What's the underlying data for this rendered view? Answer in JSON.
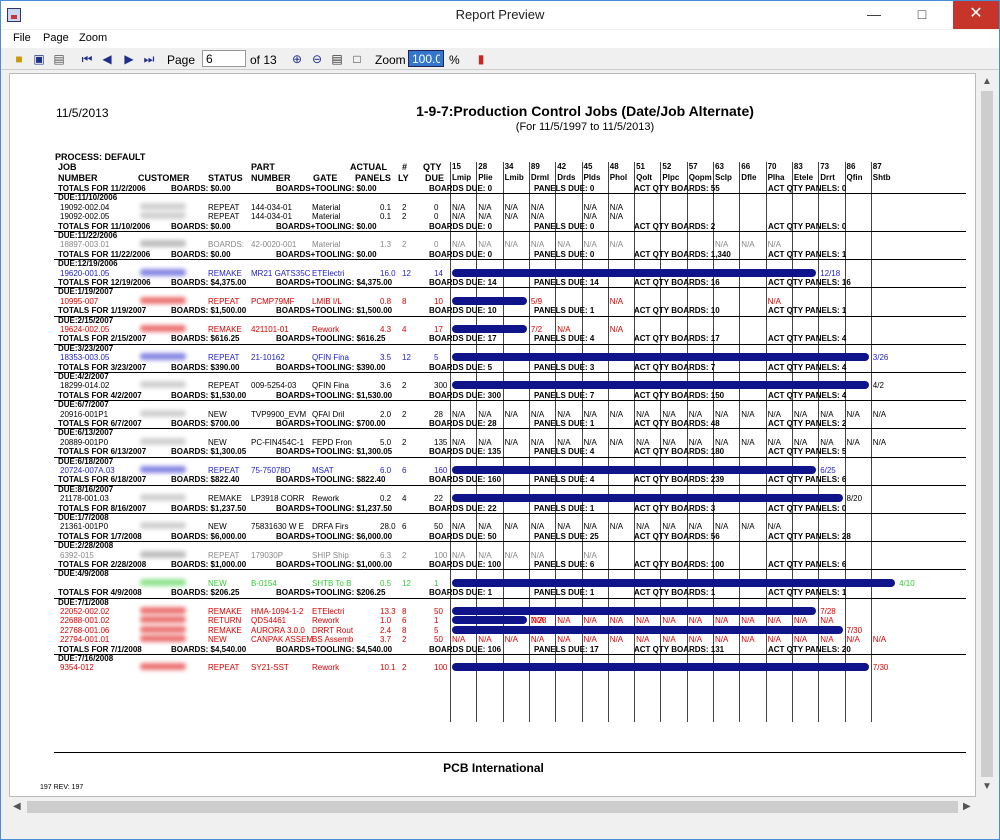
{
  "window": {
    "title": "Report Preview"
  },
  "menu": {
    "file": "File",
    "page": "Page",
    "zoom": "Zoom"
  },
  "toolbar": {
    "page_label": "Page",
    "page": "6",
    "of": "of 13",
    "zoom_label": "Zoom",
    "zoom": "100.0",
    "percent": "%"
  },
  "report": {
    "date": "11/5/2013",
    "title": "1-9-7:Production Control Jobs (Date/Job Alternate)",
    "subtitle": "(For 11/5/1997  to 11/5/2013)",
    "process": "PROCESS:  DEFAULT",
    "footer": "PCB International",
    "rev": "197  REV:  197",
    "headers": {
      "job1": "JOB",
      "job2": "NUMBER",
      "customer": "CUSTOMER",
      "status": "STATUS",
      "part1": "PART",
      "part2": "NUMBER",
      "gate": "GATE",
      "actual1": "ACTUAL",
      "actual2": "PANELS",
      "num1": "#",
      "num2": "LY",
      "qty1": "QTY",
      "qty2": "DUE"
    },
    "steps": [
      [
        "15",
        "Lmip"
      ],
      [
        "28",
        "Plie"
      ],
      [
        "34",
        "Lmib"
      ],
      [
        "89",
        "Drml"
      ],
      [
        "42",
        "Drds"
      ],
      [
        "45",
        "Plds"
      ],
      [
        "48",
        "Phol"
      ],
      [
        "51",
        "Qolt"
      ],
      [
        "52",
        "Plpc"
      ],
      [
        "57",
        "Qopm"
      ],
      [
        "63",
        "Sclp"
      ],
      [
        "66",
        "Dfle"
      ],
      [
        "70",
        "Plha"
      ],
      [
        "83",
        "Etele"
      ],
      [
        "73",
        "Drrt"
      ],
      [
        "86",
        "Qfin"
      ],
      [
        "87",
        "Shtb"
      ]
    ],
    "lines": [
      {
        "t": "total",
        "a": "TOTALS FOR 11/2/2006",
        "b": "BOARDS: $0.00",
        "c": "BOARDS+TOOLING: $0.00",
        "d": "BOARDS DUE: 0",
        "e": "PANELS DUE: 0",
        "f": "ACT QTY BOARDS: 55",
        "g": "ACT QTY PANELS: 0"
      },
      {
        "t": "due",
        "a": "DUE:11/10/2006"
      },
      {
        "t": "job",
        "job": "19092-002.04",
        "status": "REPEAT",
        "part": "144-034-01",
        "gate": "Material",
        "panels": "0.1",
        "ly": "2",
        "qty": "0",
        "na": [
          0,
          1,
          2,
          3,
          5,
          6
        ],
        "color": "#000"
      },
      {
        "t": "job",
        "job": "19092-002.05",
        "status": "REPEAT",
        "part": "144-034-01",
        "gate": "Material",
        "panels": "0.1",
        "ly": "2",
        "qty": "0",
        "na": [
          0,
          1,
          2,
          3,
          5,
          6
        ],
        "color": "#000"
      },
      {
        "t": "total",
        "a": "TOTALS FOR 11/10/2006",
        "b": "BOARDS: $0.00",
        "c": "BOARDS+TOOLING: $0.00",
        "d": "BOARDS DUE: 0",
        "e": "PANELS DUE: 0",
        "f": "ACT QTY BOARDS: 2",
        "g": "ACT QTY PANELS: 0"
      },
      {
        "t": "due",
        "a": "DUE:11/22/2006"
      },
      {
        "t": "job",
        "job": "18897-003.01",
        "status": "BOARDS:",
        "part": "42-0020-001",
        "gate": "Material",
        "panels": "1.3",
        "ly": "2",
        "qty": "0",
        "na": [
          0,
          1,
          2,
          3,
          4,
          5,
          6,
          10,
          11,
          12
        ],
        "color": "#888"
      },
      {
        "t": "total",
        "a": "TOTALS FOR 11/22/2006",
        "b": "BOARDS: $0.00",
        "c": "BOARDS+TOOLING: $0.00",
        "d": "BOARDS DUE: 0",
        "e": "PANELS DUE: 0",
        "f": "ACT QTY BOARDS: 1,340",
        "g": "ACT QTY PANELS: 1"
      },
      {
        "t": "due",
        "a": "DUE:12/19/2006"
      },
      {
        "t": "job",
        "job": "19620-001.05",
        "status": "REMAKE",
        "part": "MR21 GATS35C",
        "gate": "ETElectri",
        "panels": "16.0",
        "ly": "12",
        "qty": "14",
        "bar": [
          0,
          13
        ],
        "end": "12/18",
        "color": "#22c"
      },
      {
        "t": "total",
        "a": "TOTALS FOR 12/19/2006",
        "b": "BOARDS: $4,375.00",
        "c": "BOARDS+TOOLING: $4,375.00",
        "d": "BOARDS DUE: 14",
        "e": "PANELS DUE: 14",
        "f": "ACT QTY BOARDS: 16",
        "g": "ACT QTY PANELS: 16"
      },
      {
        "t": "due",
        "a": "DUE:1/19/2007"
      },
      {
        "t": "job",
        "job": "10995-007",
        "status": "REPEAT",
        "part": "PCMP79MF",
        "gate": "LMIB I/L",
        "panels": "0.8",
        "ly": "8",
        "qty": "10",
        "bar": [
          0,
          2
        ],
        "mid": "5/9",
        "na": [
          6,
          12
        ],
        "color": "#d00"
      },
      {
        "t": "total",
        "a": "TOTALS FOR 1/19/2007",
        "b": "BOARDS: $1,500.00",
        "c": "BOARDS+TOOLING: $1,500.00",
        "d": "BOARDS DUE: 10",
        "e": "PANELS DUE: 1",
        "f": "ACT QTY BOARDS: 10",
        "g": "ACT QTY PANELS: 1"
      },
      {
        "t": "due",
        "a": "DUE:2/15/2007"
      },
      {
        "t": "job",
        "job": "19624-002.05",
        "status": "REMAKE",
        "part": "421101-01",
        "gate": "Rework",
        "panels": "4.3",
        "ly": "4",
        "qty": "17",
        "bar": [
          0,
          2
        ],
        "mid": "7/2",
        "na": [
          4,
          6
        ],
        "color": "#d00"
      },
      {
        "t": "total",
        "a": "TOTALS FOR 2/15/2007",
        "b": "BOARDS: $616.25",
        "c": "BOARDS+TOOLING: $616.25",
        "d": "BOARDS DUE: 17",
        "e": "PANELS DUE: 4",
        "f": "ACT QTY BOARDS: 17",
        "g": "ACT QTY PANELS: 4"
      },
      {
        "t": "due",
        "a": "DUE:3/23/2007"
      },
      {
        "t": "job",
        "job": "18353-003.05",
        "status": "REPEAT",
        "part": "21-10162",
        "gate": "QFIN Fina",
        "panels": "3.5",
        "ly": "12",
        "qty": "5",
        "bar": [
          0,
          15
        ],
        "end": "3/26",
        "color": "#22c"
      },
      {
        "t": "total",
        "a": "TOTALS FOR 3/23/2007",
        "b": "BOARDS: $390.00",
        "c": "BOARDS+TOOLING: $390.00",
        "d": "BOARDS DUE: 5",
        "e": "PANELS DUE: 3",
        "f": "ACT QTY BOARDS: 7",
        "g": "ACT QTY PANELS: 4"
      },
      {
        "t": "due",
        "a": "DUE:4/2/2007"
      },
      {
        "t": "job",
        "job": "18299-014.02",
        "status": "REPEAT",
        "part": "009-5254-03",
        "gate": "QFIN Fina",
        "panels": "3.6",
        "ly": "2",
        "qty": "300",
        "bar": [
          0,
          15
        ],
        "end": "4/2",
        "color": "#000"
      },
      {
        "t": "total",
        "a": "TOTALS FOR 4/2/2007",
        "b": "BOARDS: $1,530.00",
        "c": "BOARDS+TOOLING: $1,530.00",
        "d": "BOARDS DUE: 300",
        "e": "PANELS DUE: 7",
        "f": "ACT QTY BOARDS: 150",
        "g": "ACT QTY PANELS: 4"
      },
      {
        "t": "due",
        "a": "DUE:6/7/2007"
      },
      {
        "t": "job",
        "job": "20916-001P1",
        "status": "NEW",
        "part": "TVP9900_EVM",
        "gate": "QFAI Dril",
        "panels": "2.0",
        "ly": "2",
        "qty": "28",
        "na": [
          0,
          1,
          2,
          3,
          4,
          5,
          6,
          7,
          8,
          9,
          10,
          11,
          12,
          13,
          14,
          15,
          16
        ],
        "color": "#000"
      },
      {
        "t": "total",
        "a": "TOTALS FOR 6/7/2007",
        "b": "BOARDS: $700.00",
        "c": "BOARDS+TOOLING: $700.00",
        "d": "BOARDS DUE: 28",
        "e": "PANELS DUE: 1",
        "f": "ACT QTY BOARDS: 48",
        "g": "ACT QTY PANELS: 2"
      },
      {
        "t": "due",
        "a": "DUE:6/13/2007"
      },
      {
        "t": "job",
        "job": "20889-001P0",
        "status": "NEW",
        "part": "PC-FIN454C-1",
        "gate": "FEPD Fron",
        "panels": "5.0",
        "ly": "2",
        "qty": "135",
        "na": [
          0,
          1,
          2,
          3,
          4,
          5,
          6,
          7,
          8,
          9,
          10,
          11,
          12,
          13,
          14,
          15,
          16
        ],
        "color": "#000"
      },
      {
        "t": "total",
        "a": "TOTALS FOR 6/13/2007",
        "b": "BOARDS: $1,300.05",
        "c": "BOARDS+TOOLING: $1,300.05",
        "d": "BOARDS DUE: 135",
        "e": "PANELS DUE: 4",
        "f": "ACT QTY BOARDS: 180",
        "g": "ACT QTY PANELS: 5"
      },
      {
        "t": "due",
        "a": "DUE:6/18/2007"
      },
      {
        "t": "job",
        "job": "20724-007A.03",
        "status": "REPEAT",
        "part": "75-75078D",
        "gate": "MSAT",
        "panels": "6.0",
        "ly": "6",
        "qty": "160",
        "bar": [
          0,
          13
        ],
        "end": "6/25",
        "color": "#22c"
      },
      {
        "t": "total",
        "a": "TOTALS FOR 6/18/2007",
        "b": "BOARDS: $822.40",
        "c": "BOARDS+TOOLING: $822.40",
        "d": "BOARDS DUE: 160",
        "e": "PANELS DUE: 4",
        "f": "ACT QTY BOARDS: 239",
        "g": "ACT QTY PANELS: 6"
      },
      {
        "t": "due",
        "a": "DUE:8/16/2007"
      },
      {
        "t": "job",
        "job": "21178-001.03",
        "status": "REMAKE",
        "part": "LP3918 CORR",
        "gate": "Rework",
        "panels": "0.2",
        "ly": "4",
        "qty": "22",
        "bar": [
          0,
          14
        ],
        "end": "8/20",
        "color": "#000"
      },
      {
        "t": "total",
        "a": "TOTALS FOR 8/16/2007",
        "b": "BOARDS: $1,237.50",
        "c": "BOARDS+TOOLING: $1,237.50",
        "d": "BOARDS DUE: 22",
        "e": "PANELS DUE: 1",
        "f": "ACT QTY BOARDS: 3",
        "g": "ACT QTY PANELS: 0"
      },
      {
        "t": "due",
        "a": "DUE:1/7/2008"
      },
      {
        "t": "job",
        "job": "21361-001P0",
        "status": "NEW",
        "part": "75831630 W E",
        "gate": "DRFA Firs",
        "panels": "28.0",
        "ly": "6",
        "qty": "50",
        "na": [
          0,
          1,
          2,
          3,
          4,
          5,
          6,
          7,
          8,
          9,
          10,
          11,
          12
        ],
        "color": "#000"
      },
      {
        "t": "total",
        "a": "TOTALS FOR 1/7/2008",
        "b": "BOARDS: $6,000.00",
        "c": "BOARDS+TOOLING: $6,000.00",
        "d": "BOARDS DUE: 50",
        "e": "PANELS DUE: 25",
        "f": "ACT QTY BOARDS: 56",
        "g": "ACT QTY PANELS: 28"
      },
      {
        "t": "due",
        "a": "DUE:2/28/2008"
      },
      {
        "t": "job",
        "job": "6392-015",
        "status": "REPEAT",
        "part": "179030P",
        "gate": "SHIP Ship",
        "panels": "6.3",
        "ly": "2",
        "qty": "100",
        "na": [
          0,
          1,
          2,
          3,
          5
        ],
        "color": "#888"
      },
      {
        "t": "total",
        "a": "TOTALS FOR 2/28/2008",
        "b": "BOARDS: $1,000.00",
        "c": "BOARDS+TOOLING: $1,000.00",
        "d": "BOARDS DUE: 100",
        "e": "PANELS DUE: 6",
        "f": "ACT QTY BOARDS: 100",
        "g": "ACT QTY PANELS: 6"
      },
      {
        "t": "due",
        "a": "DUE:4/9/2008"
      },
      {
        "t": "job",
        "job": "",
        "status": "NEW",
        "part": "B-0154",
        "gate": "SHTB To B",
        "panels": "0.5",
        "ly": "12",
        "qty": "1",
        "bar": [
          0,
          16
        ],
        "end": "4/10",
        "color": "#3c3"
      },
      {
        "t": "total",
        "a": "TOTALS FOR 4/9/2008",
        "b": "BOARDS: $206.25",
        "c": "BOARDS+TOOLING: $206.25",
        "d": "BOARDS DUE: 1",
        "e": "PANELS DUE: 1",
        "f": "ACT QTY BOARDS: 1",
        "g": "ACT QTY PANELS: 1"
      },
      {
        "t": "due",
        "a": "DUE:7/1/2008"
      },
      {
        "t": "job",
        "job": "22052-002.02",
        "status": "REMAKE",
        "part": "HMA-1094-1-2",
        "gate": "ETElectri",
        "panels": "13.3",
        "ly": "8",
        "qty": "50",
        "bar": [
          0,
          13
        ],
        "end": "7/28",
        "color": "#d00"
      },
      {
        "t": "job",
        "job": "22688-001.02",
        "status": "RETURN",
        "part": "QDS4461",
        "gate": "Rework",
        "panels": "1.0",
        "ly": "6",
        "qty": "1",
        "bar": [
          0,
          2
        ],
        "mid": "7/28",
        "na": [
          3,
          4,
          5,
          6,
          7,
          8,
          9,
          10,
          11,
          12,
          13,
          14
        ],
        "color": "#d00"
      },
      {
        "t": "job",
        "job": "22768-001.06",
        "status": "REMAKE",
        "part": "AURORA 3.0.0",
        "gate": "DRRT Rout",
        "panels": "2.4",
        "ly": "8",
        "qty": "5",
        "bar": [
          0,
          14
        ],
        "end": "7/30",
        "color": "#d00"
      },
      {
        "t": "job",
        "job": "22794-001.01",
        "status": "NEW",
        "part": "CANPAK ASSEM",
        "gate": "BS Assemb",
        "panels": "3.7",
        "ly": "2",
        "qty": "50",
        "na": [
          0,
          1,
          2,
          3,
          4,
          5,
          6,
          7,
          8,
          9,
          10,
          11,
          12,
          13,
          14,
          15,
          16
        ],
        "color": "#d00"
      },
      {
        "t": "total",
        "a": "TOTALS FOR 7/1/2008",
        "b": "BOARDS: $4,540.00",
        "c": "BOARDS+TOOLING: $4,540.00",
        "d": "BOARDS DUE: 106",
        "e": "PANELS DUE: 17",
        "f": "ACT QTY BOARDS: 131",
        "g": "ACT QTY PANELS: 20"
      },
      {
        "t": "due",
        "a": "DUE:7/16/2008"
      },
      {
        "t": "job",
        "job": "9354-012",
        "status": "REPEAT",
        "part": "SY21-SST",
        "gate": "Rework",
        "panels": "10.1",
        "ly": "2",
        "qty": "100",
        "bar": [
          0,
          15
        ],
        "end": "7/30",
        "color": "#d00"
      }
    ]
  },
  "na_label": "N/A"
}
